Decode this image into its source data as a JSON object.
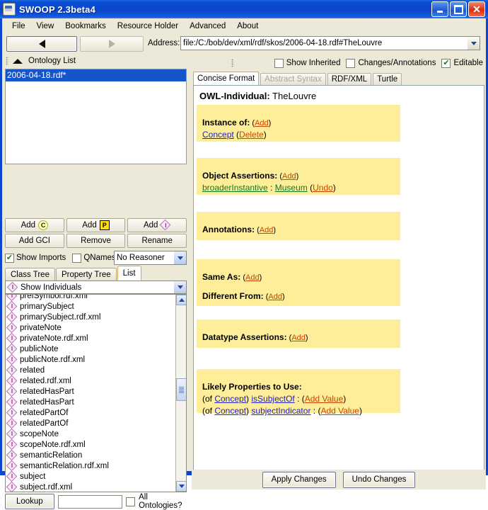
{
  "window": {
    "title": "SWOOP 2.3beta4",
    "app_icon": "java-coffee-icon",
    "buttons": {
      "minimize": "minimize-icon",
      "maximize": "maximize-icon",
      "close": "close-icon"
    }
  },
  "menubar": {
    "items": [
      "File",
      "View",
      "Bookmarks",
      "Resource Holder",
      "Advanced",
      "About"
    ]
  },
  "navbar": {
    "back_icon": "back-triangle-icon",
    "forward_icon": "forward-triangle-icon",
    "address_label": "Address:",
    "address_value": "file:/C:/bob/dev/xml/rdf/skos/2006-04-18.rdf#TheLouvre",
    "address_dropdown_icon": "chevron-down-icon"
  },
  "left_panel": {
    "header": {
      "collapse_icon": "triangle-up-icon",
      "title": "Ontology List"
    },
    "ontology_list": {
      "items": [
        "2006-04-18.rdf*"
      ],
      "selected_index": 0
    },
    "buttons_row1": [
      {
        "label": "Add",
        "icon": "class-icon",
        "icon_letter": "C"
      },
      {
        "label": "Add",
        "icon": "property-icon",
        "icon_letter": "P"
      },
      {
        "label": "Add",
        "icon": "individual-icon",
        "icon_letter": "I"
      }
    ],
    "buttons_row2": [
      {
        "label": "Add GCI"
      },
      {
        "label": "Remove"
      },
      {
        "label": "Rename"
      }
    ],
    "options": {
      "show_imports": {
        "label": "Show Imports",
        "checked": true
      },
      "qnames": {
        "label": "QNames",
        "checked": false
      },
      "reasoner": {
        "value": "No Reasoner",
        "dropdown_icon": "chevron-down-icon"
      }
    },
    "tabs": [
      {
        "label": "Class Tree",
        "active": false
      },
      {
        "label": "Property Tree",
        "active": false
      },
      {
        "label": "List",
        "active": true
      }
    ],
    "entity_filter": {
      "icon": "individual-icon",
      "value": "Show Individuals",
      "dropdown_icon": "chevron-down-icon"
    },
    "individuals": [
      "prefSymbol.rdf.xml",
      "primarySubject",
      "primarySubject.rdf.xml",
      "privateNote",
      "privateNote.rdf.xml",
      "publicNote",
      "publicNote.rdf.xml",
      "related",
      "related.rdf.xml",
      "relatedHasPart",
      "relatedHasPart",
      "relatedPartOf",
      "relatedPartOf",
      "scopeNote",
      "scopeNote.rdf.xml",
      "semanticRelation",
      "semanticRelation.rdf.xml",
      "subject",
      "subject.rdf.xml"
    ],
    "scrollbar": {
      "up_icon": "chevron-up-icon",
      "down_icon": "chevron-down-icon"
    },
    "lookup": {
      "button_label": "Lookup",
      "field_value": "",
      "all_ontologies": {
        "label": "All Ontologies?",
        "checked": false
      }
    }
  },
  "right_panel": {
    "toolbar": {
      "show_inherited": {
        "label": "Show Inherited",
        "checked": false
      },
      "changes_annotations": {
        "label": "Changes/Annotations",
        "checked": false
      },
      "editable": {
        "label": "Editable",
        "checked": true
      }
    },
    "tabs": [
      {
        "label": "Concise Format",
        "active": true,
        "disabled": false
      },
      {
        "label": "Abstract Syntax",
        "active": false,
        "disabled": true
      },
      {
        "label": "RDF/XML",
        "active": false,
        "disabled": false
      },
      {
        "label": "Turtle",
        "active": false,
        "disabled": false
      }
    ],
    "entity_type": "OWL-Individual:",
    "entity_name": "TheLouvre",
    "sections": [
      {
        "id": "instance-of",
        "title": "Instance of:",
        "title_action": "Add",
        "rows": [
          {
            "parts": [
              {
                "text": "Concept",
                "style": "blue-link"
              },
              {
                "text": " ",
                "style": "plain"
              },
              {
                "text": "(",
                "style": "plain"
              },
              {
                "text": "Delete",
                "style": "red-link"
              },
              {
                "text": ")",
                "style": "plain"
              }
            ]
          }
        ]
      },
      {
        "id": "object-assertions",
        "title": "Object Assertions:",
        "title_action": "Add",
        "rows": [
          {
            "parts": [
              {
                "text": "broaderInstantive",
                "style": "green-link"
              },
              {
                "text": " : ",
                "style": "plain"
              },
              {
                "text": "Museum",
                "style": "green-link"
              },
              {
                "text": "  (",
                "style": "plain"
              },
              {
                "text": "Undo",
                "style": "red-link"
              },
              {
                "text": ")",
                "style": "plain"
              }
            ]
          }
        ]
      },
      {
        "id": "annotations",
        "title": "Annotations:",
        "title_action": "Add",
        "rows": []
      },
      {
        "id": "same-as-different-from",
        "title": "Same As:",
        "title_action": "Add",
        "second_title": "Different From:",
        "second_action": "Add",
        "rows": []
      },
      {
        "id": "datatype-assertions",
        "title": "Datatype Assertions:",
        "title_action": "Add",
        "rows": []
      },
      {
        "id": "likely-properties",
        "title": "Likely Properties to Use:",
        "title_action": "",
        "rows": [
          {
            "parts": [
              {
                "text": "(of ",
                "style": "plain"
              },
              {
                "text": "Concept",
                "style": "blue-link"
              },
              {
                "text": ") ",
                "style": "plain"
              },
              {
                "text": "isSubjectOf",
                "style": "blue-link"
              },
              {
                "text": " :   (",
                "style": "plain"
              },
              {
                "text": "Add Value",
                "style": "red-link"
              },
              {
                "text": ")",
                "style": "plain"
              }
            ]
          },
          {
            "parts": [
              {
                "text": "(of ",
                "style": "plain"
              },
              {
                "text": "Concept",
                "style": "blue-link"
              },
              {
                "text": ") ",
                "style": "plain"
              },
              {
                "text": "subjectIndicator",
                "style": "blue-link"
              },
              {
                "text": " :   (",
                "style": "plain"
              },
              {
                "text": "Add Value",
                "style": "red-link"
              },
              {
                "text": ")",
                "style": "plain"
              }
            ]
          }
        ]
      }
    ]
  },
  "bottom_bar": {
    "apply_label": "Apply Changes",
    "undo_label": "Undo Changes"
  },
  "colors": {
    "titlebar_blue": "#0a46cd",
    "panel_yellow": "#ffee99",
    "selection_blue": "#1555cc",
    "face": "#ece9d8",
    "link_red": "#cc4400",
    "link_blue": "#2222bb",
    "link_green": "#117a22"
  }
}
